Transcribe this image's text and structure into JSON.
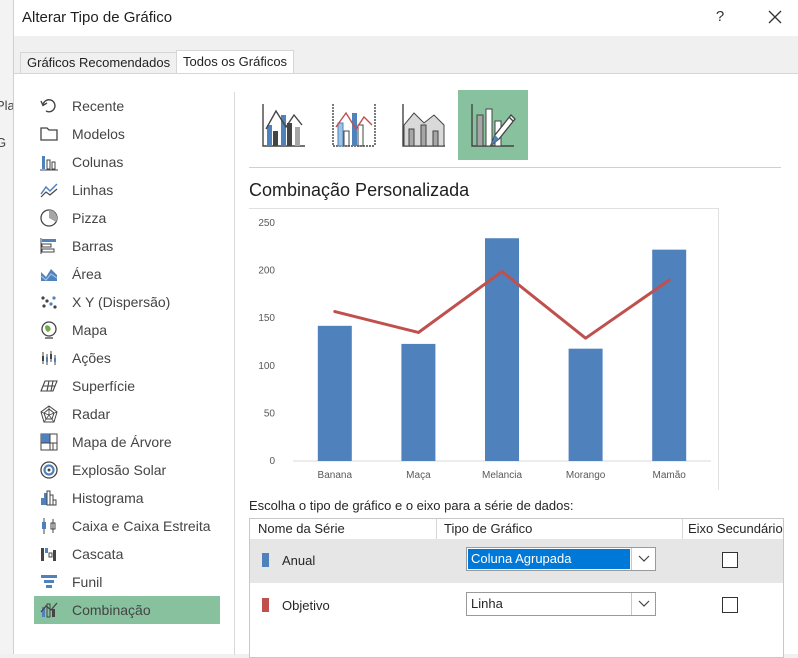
{
  "window": {
    "title": "Alterar Tipo de Gráfico",
    "help_label": "?"
  },
  "background_fragments": [
    "Pla",
    "G"
  ],
  "tabs": [
    {
      "label": "Gráficos Recomendados",
      "active": false
    },
    {
      "label": "Todos os Gráficos",
      "active": true
    }
  ],
  "nav": {
    "selected": "Combinação",
    "items": [
      {
        "label": "Recente",
        "icon": "recent-icon"
      },
      {
        "label": "Modelos",
        "icon": "folder-icon"
      },
      {
        "label": "Colunas",
        "icon": "column-chart-icon"
      },
      {
        "label": "Linhas",
        "icon": "line-chart-icon"
      },
      {
        "label": "Pizza",
        "icon": "pie-chart-icon"
      },
      {
        "label": "Barras",
        "icon": "bar-chart-icon"
      },
      {
        "label": "Área",
        "icon": "area-chart-icon"
      },
      {
        "label": "X Y (Dispersão)",
        "icon": "scatter-chart-icon"
      },
      {
        "label": "Mapa",
        "icon": "map-chart-icon"
      },
      {
        "label": "Ações",
        "icon": "stock-chart-icon"
      },
      {
        "label": "Superfície",
        "icon": "surface-chart-icon"
      },
      {
        "label": "Radar",
        "icon": "radar-chart-icon"
      },
      {
        "label": "Mapa de Árvore",
        "icon": "treemap-chart-icon"
      },
      {
        "label": "Explosão Solar",
        "icon": "sunburst-chart-icon"
      },
      {
        "label": "Histograma",
        "icon": "histogram-chart-icon"
      },
      {
        "label": "Caixa e Caixa Estreita",
        "icon": "box-whisker-chart-icon"
      },
      {
        "label": "Cascata",
        "icon": "waterfall-chart-icon"
      },
      {
        "label": "Funil",
        "icon": "funnel-chart-icon"
      },
      {
        "label": "Combinação",
        "icon": "combo-chart-icon"
      }
    ]
  },
  "combo_subtypes": [
    {
      "name": "clustered-column-line",
      "icon": "combo-column-line-icon",
      "selected": false
    },
    {
      "name": "clustered-column-line-secondary",
      "icon": "combo-column-line-secondary-icon",
      "selected": false
    },
    {
      "name": "stacked-area-column",
      "icon": "combo-area-column-icon",
      "selected": false
    },
    {
      "name": "custom-combination",
      "icon": "custom-combo-icon",
      "selected": true
    }
  ],
  "section_title": "Combinação Personalizada",
  "chart_data": {
    "type": "bar",
    "title": "",
    "xlabel": "",
    "ylabel": "",
    "categories": [
      "Banana",
      "Maça",
      "Melancia",
      "Morango",
      "Mamão"
    ],
    "ylim": [
      0,
      250
    ],
    "yticks": [
      "0",
      "50",
      "100",
      "150",
      "200",
      "250"
    ],
    "yticks_values": [
      0,
      50,
      100,
      150,
      200,
      250
    ],
    "grid": false,
    "series": [
      {
        "values": [
          142,
          123,
          234,
          118,
          222
        ],
        "color": "#4f81bd",
        "render": "bar"
      },
      {
        "values": [
          157,
          135,
          199,
          129,
          190
        ],
        "color": "#c0504d",
        "render": "line"
      }
    ]
  },
  "series_section": {
    "prompt": "Escolha o tipo de gráfico e o eixo para a série de dados:",
    "headers": {
      "name": "Nome da Série",
      "type": "Tipo de Gráfico",
      "secondary": "Eixo Secundário"
    },
    "rows": [
      {
        "name": "Anual",
        "color": "#4f81bd",
        "chart_type": "Coluna Agrupada",
        "secondary_axis": false,
        "focused": true
      },
      {
        "name": "Objetivo",
        "color": "#c0504d",
        "chart_type": "Linha",
        "secondary_axis": false,
        "focused": false
      }
    ]
  },
  "colors": {
    "selection": "#88c19e",
    "focus": "#0078d7"
  }
}
